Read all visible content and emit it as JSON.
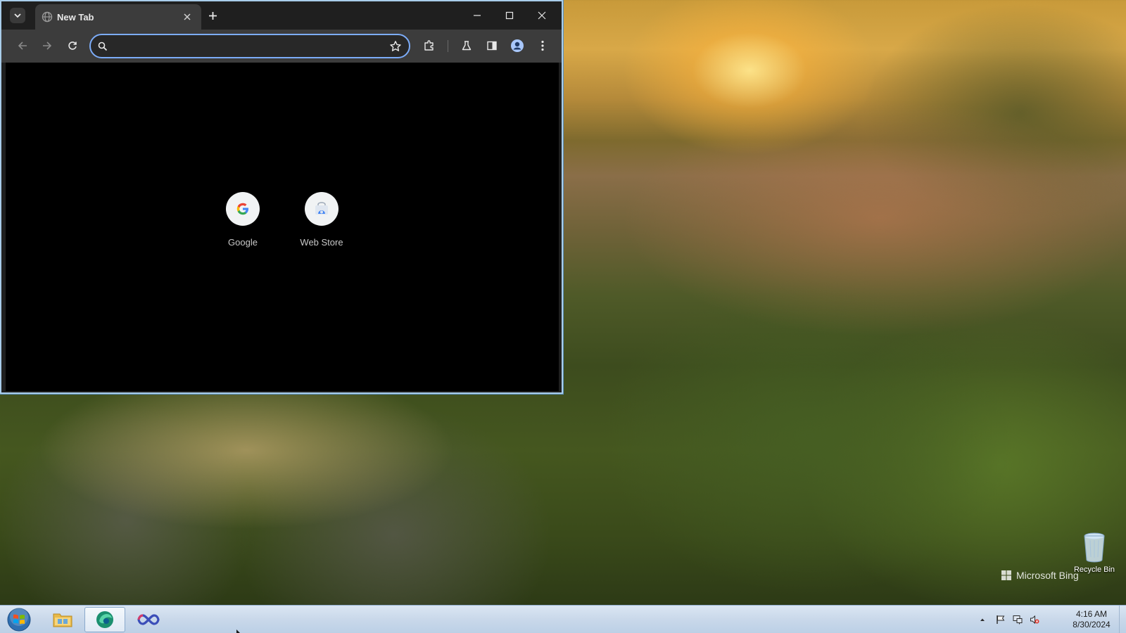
{
  "browser": {
    "tab": {
      "title": "New Tab"
    },
    "omnibox": {
      "value": "",
      "placeholder": ""
    },
    "accent_color": "#7cacf8",
    "shortcuts": [
      {
        "label": "Google",
        "icon": "google-g-icon"
      },
      {
        "label": "Web Store",
        "icon": "web-store-icon"
      }
    ]
  },
  "desktop": {
    "recycle_bin_label": "Recycle Bin",
    "watermark": "Microsoft Bing"
  },
  "taskbar": {
    "pinned": [
      "file-explorer-icon",
      "browser-icon",
      "infinity-app-icon"
    ],
    "clock": {
      "time": "4:16 AM",
      "date": "8/30/2024"
    }
  }
}
